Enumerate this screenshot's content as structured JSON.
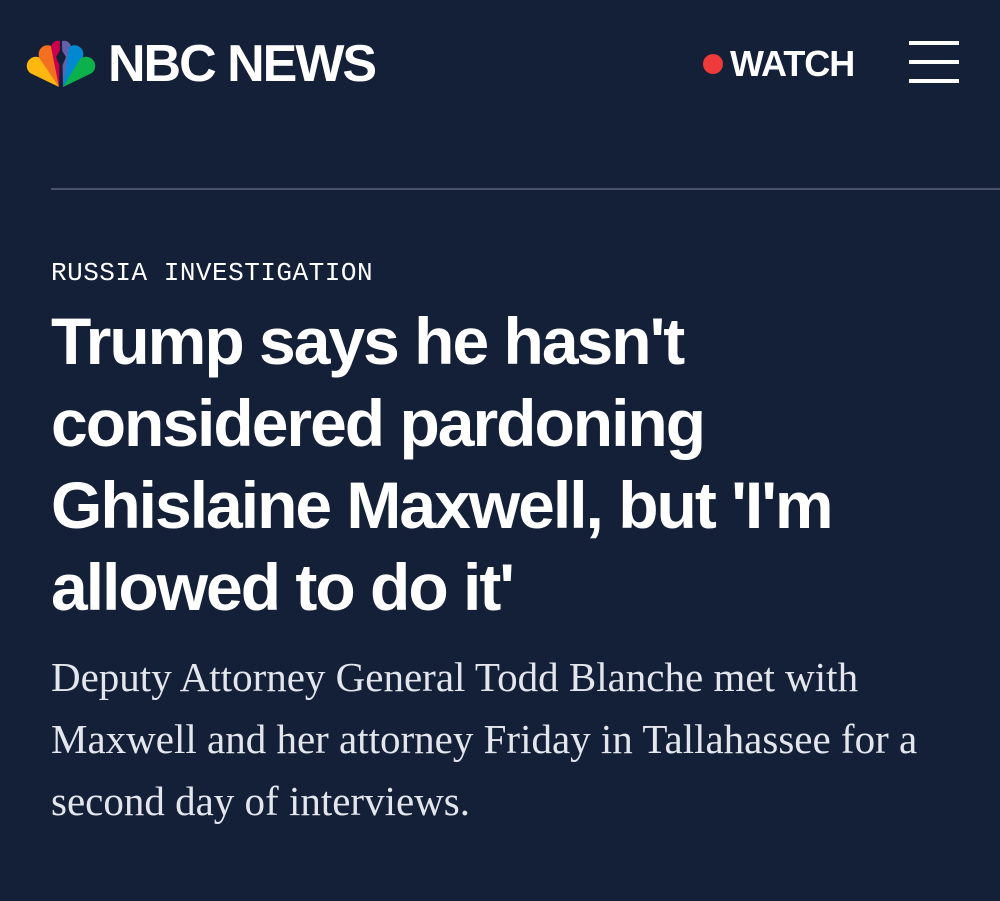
{
  "header": {
    "brand": "NBC NEWS",
    "logo_icon": "nbc-peacock-icon",
    "watch_label": "WATCH",
    "live_dot_color": "#ee3a3a",
    "menu_icon": "hamburger-menu-icon"
  },
  "article": {
    "category": "RUSSIA INVESTIGATION",
    "headline": "Trump says he hasn't considered pardoning Ghislaine Maxwell, but 'I'm allowed to do it'",
    "dek": "Deputy Attorney General Todd Blanche met with Maxwell and her attorney Friday in Tallahassee for a second day of interviews."
  },
  "colors": {
    "background": "#141f38",
    "text": "#ffffff",
    "divider": "#48536a",
    "peacock": [
      "#fcb711",
      "#f37021",
      "#cc004c",
      "#6460aa",
      "#0089d0",
      "#0db14b"
    ]
  }
}
